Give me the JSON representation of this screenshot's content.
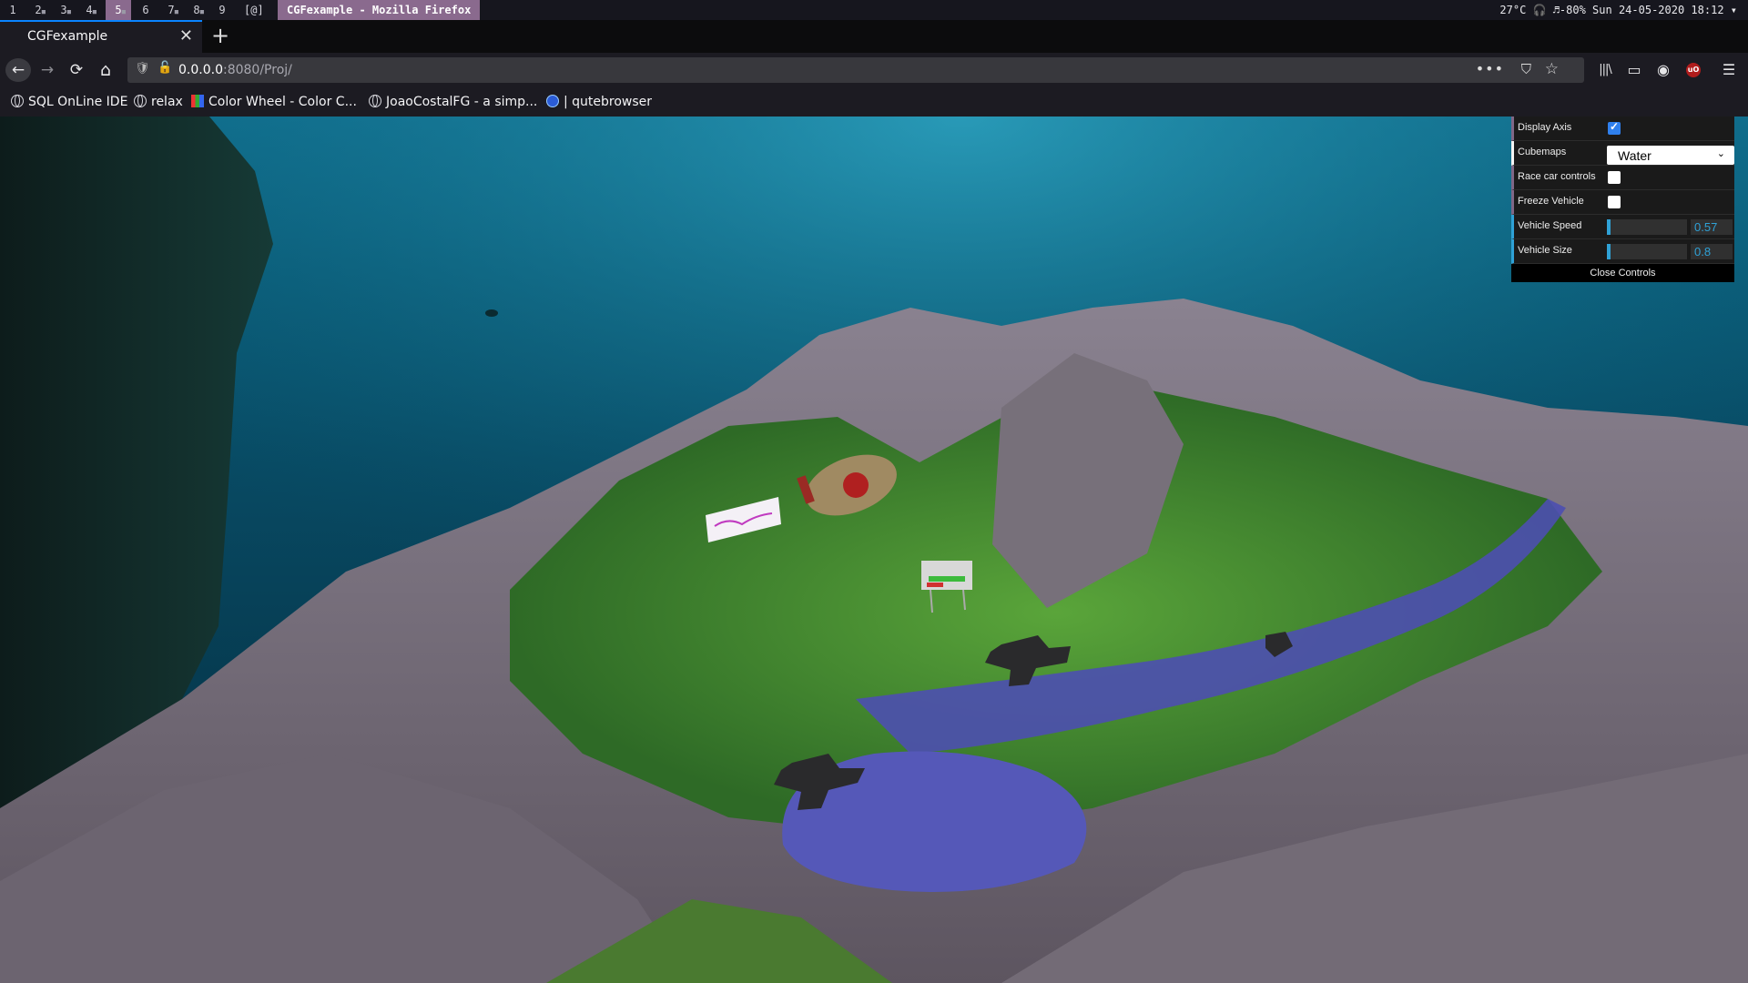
{
  "wm": {
    "workspaces": [
      "1",
      "2",
      "3",
      "4",
      "5",
      "6",
      "7",
      "8",
      "9"
    ],
    "active_workspace": "5",
    "layout_tag": "[@]",
    "window_title": "CGFexample - Mozilla Firefox",
    "status": "27°C 🎧 ♬-80% Sun 24-05-2020 18:12 ▾"
  },
  "browser": {
    "tab_title": "CGFexample",
    "new_tab": "+",
    "close_tab": "✕",
    "url_host": "0.0.0.0",
    "url_rest": ":8080/Proj/",
    "nav": {
      "back": "←",
      "forward": "→",
      "reload": "⟳",
      "home": "⌂"
    },
    "icons": {
      "page_actions": "•••",
      "pocket": "⛉",
      "bookmark_star": "☆",
      "library": "|||\\",
      "sidebar": "▭",
      "account": "◉",
      "ublock": "uO",
      "menu": "☰"
    }
  },
  "bookmarks": [
    {
      "label": "SQL OnLine IDE",
      "icon": "globe-icon"
    },
    {
      "label": "relax",
      "icon": "globe-icon"
    },
    {
      "label": "Color Wheel - Color C...",
      "icon": "color-wheel-icon"
    },
    {
      "label": "JoaoCostalFG - a simp...",
      "icon": "globe-icon"
    },
    {
      "label": "| qutebrowser",
      "icon": "qutebrowser-icon"
    }
  ],
  "gui": {
    "display_axis": {
      "label": "Display Axis",
      "checked": true
    },
    "cubemaps": {
      "label": "Cubemaps",
      "value": "Water"
    },
    "race_car": {
      "label": "Race car controls",
      "checked": false
    },
    "freeze": {
      "label": "Freeze Vehicle",
      "checked": false
    },
    "speed": {
      "label": "Vehicle Speed",
      "value": "0.57",
      "fraction": 0.05
    },
    "size": {
      "label": "Vehicle Size",
      "value": "0.8",
      "fraction": 0.04
    },
    "close": "Close Controls"
  },
  "colors": {
    "accent": "#2fa1d6",
    "bool_accent": "#806787",
    "active_tab": "#0a84ff",
    "wm_active": "#8a6a8e"
  }
}
